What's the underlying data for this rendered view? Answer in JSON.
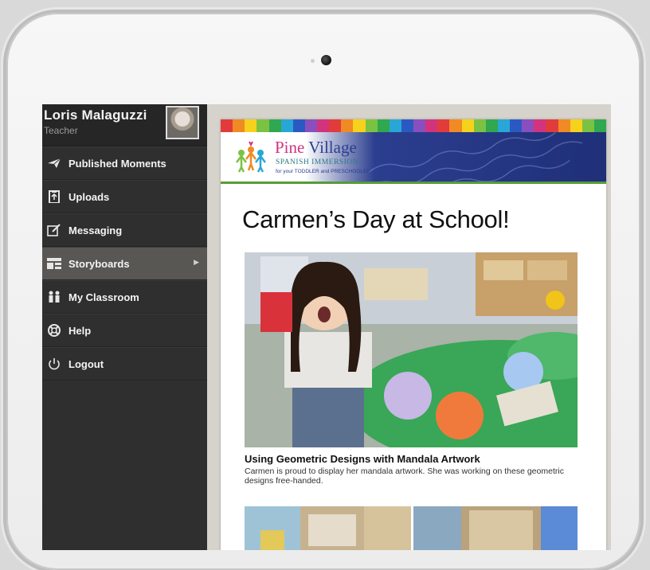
{
  "profile": {
    "name": "Loris Malaguzzi",
    "role": "Teacher"
  },
  "nav": [
    {
      "label": "Published Moments",
      "icon": "paper-plane-icon",
      "active": false
    },
    {
      "label": "Uploads",
      "icon": "upload-clipboard-icon",
      "active": false
    },
    {
      "label": "Messaging",
      "icon": "compose-icon",
      "active": false
    },
    {
      "label": "Storyboards",
      "icon": "storyboard-layout-icon",
      "active": true
    },
    {
      "label": "My Classroom",
      "icon": "people-icon",
      "active": false
    },
    {
      "label": "Help",
      "icon": "lifebuoy-icon",
      "active": false
    },
    {
      "label": "Logout",
      "icon": "power-icon",
      "active": false
    }
  ],
  "banner": {
    "title_part1": "Pine",
    "title_part2": "Village",
    "subtitle": "SPANISH IMMERSION",
    "tagline": "for your TODDLER and PRESCHOOLER",
    "stripe_colors": [
      "#e23b3b",
      "#f08a24",
      "#f6d21c",
      "#7cc242",
      "#2fa84f",
      "#28a7d6",
      "#2b59c3",
      "#8a4fbf",
      "#d2337d",
      "#e23b3b",
      "#f08a24",
      "#f6d21c",
      "#7cc242",
      "#2fa84f",
      "#28a7d6",
      "#2b59c3",
      "#8a4fbf",
      "#d2337d",
      "#e23b3b",
      "#f08a24",
      "#f6d21c",
      "#7cc242",
      "#2fa84f",
      "#28a7d6",
      "#2b59c3",
      "#8a4fbf",
      "#d2337d",
      "#e23b3b",
      "#f08a24",
      "#f6d21c",
      "#7cc242",
      "#2fa84f"
    ]
  },
  "story": {
    "title": "Carmen’s Day at School!",
    "caption_title": "Using Geometric Designs with Mandala Artwork",
    "caption_text": "Carmen is proud to display her mandala artwork. She was working on these geometric designs free-handed."
  },
  "colors": {
    "sidebar": "#2f2f2f",
    "active_item": "#595754",
    "banner_blue": "#2b3e8f",
    "brand_pink": "#d2337d"
  }
}
